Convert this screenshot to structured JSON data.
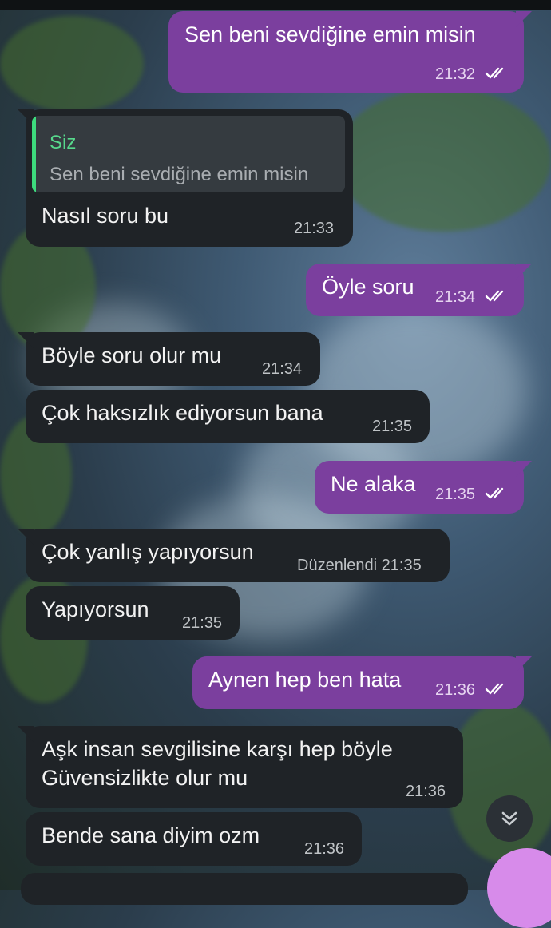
{
  "colors": {
    "incoming_bubble": "#1f2327",
    "outgoing_bubble": "#7b3f9e",
    "reply_name": "#57d98c",
    "fab": "#d78bea"
  },
  "messages": [
    {
      "text": "Sen beni sevdiğine emin misin",
      "time": "21:32"
    },
    {
      "reply_name": "Siz",
      "reply_text": "Sen beni sevdiğine emin misin",
      "text": "Nasıl soru bu",
      "time": "21:33"
    },
    {
      "text": "Öyle soru",
      "time": "21:34"
    },
    {
      "text": "Böyle soru olur mu",
      "time": "21:34"
    },
    {
      "text": "Çok haksızlık ediyorsun bana",
      "time": "21:35"
    },
    {
      "text": "Ne alaka",
      "time": "21:35"
    },
    {
      "text": "Çok yanlış yapıyorsun",
      "edited": "Düzenlendi",
      "time": "21:35"
    },
    {
      "text": "Yapıyorsun",
      "time": "21:35"
    },
    {
      "text": "Aynen hep ben hata",
      "time": "21:36"
    },
    {
      "text_line1": "Aşk insan sevgilisine karşı hep böyle",
      "text_line2": "Güvensizlikte olur mu",
      "time": "21:36"
    },
    {
      "text": "Bende sana diyim ozm",
      "time": "21:36"
    }
  ],
  "icons": {
    "read_receipt": "double-check-icon",
    "scroll_down": "chevrons-down-icon"
  }
}
